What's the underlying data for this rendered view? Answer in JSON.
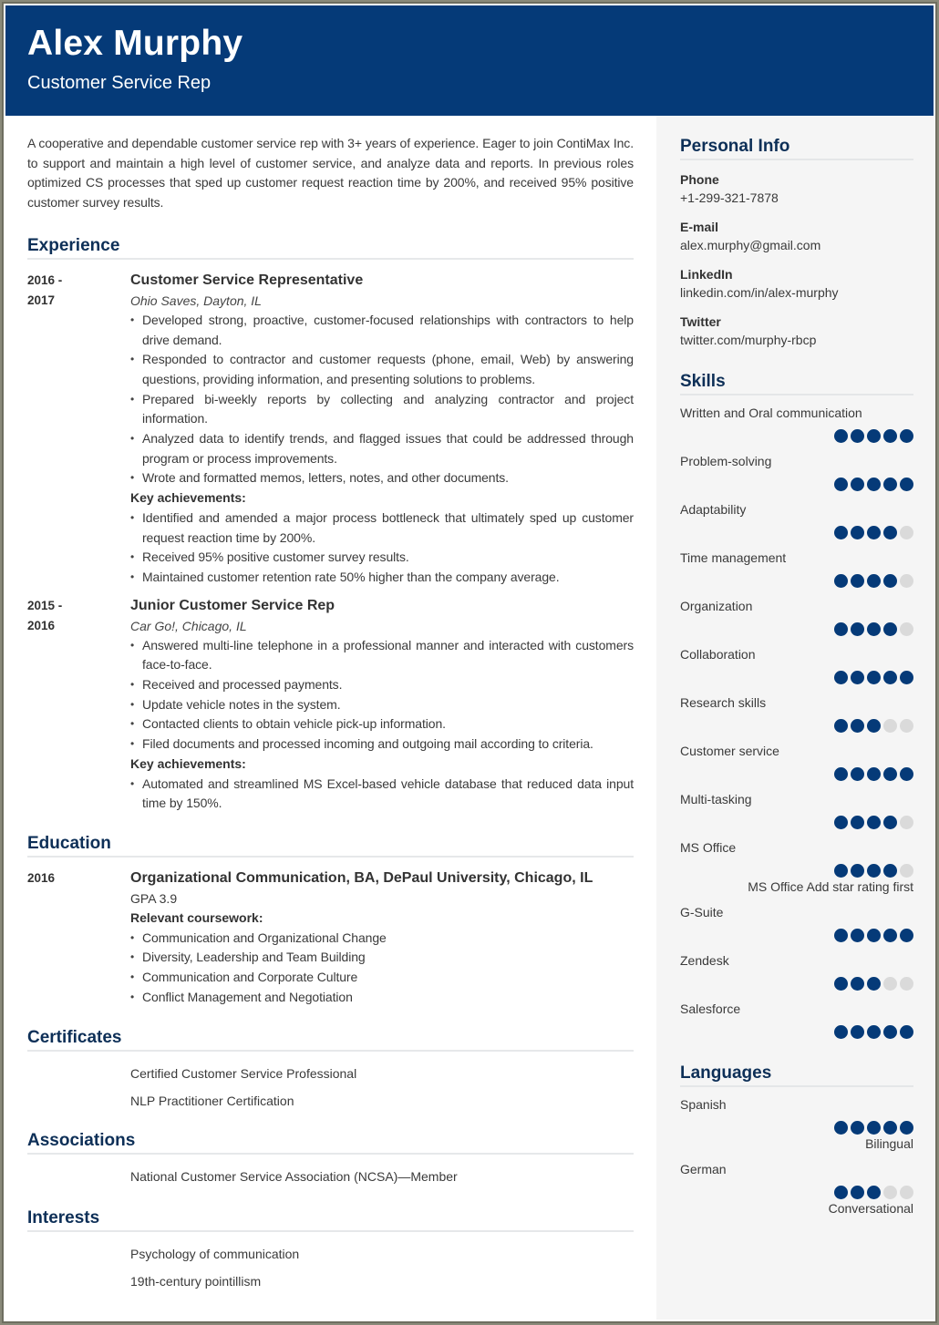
{
  "header": {
    "name": "Alex Murphy",
    "role": "Customer Service Rep"
  },
  "colors": {
    "accent": "#053a78",
    "heading": "#0d2f57",
    "sidebar_bg": "#f5f5f5",
    "dot_empty": "#dadada"
  },
  "summary": "A cooperative and dependable customer service rep with 3+ years of experience. Eager to join ContiMax Inc. to support and maintain a high level of customer service, and analyze data and reports. In previous roles optimized CS processes that sped up customer request reaction time by 200%, and received 95% positive customer survey results.",
  "experience": {
    "title": "Experience",
    "jobs": [
      {
        "date_start": "2016 -",
        "date_end": "2017",
        "title": "Customer Service Representative",
        "company": "Ohio Saves, Dayton, IL",
        "duties": [
          "Developed strong, proactive, customer-focused relationships with contractors to help drive demand.",
          "Responded to contractor and customer requests (phone, email, Web) by answering questions, providing information, and presenting solutions to problems.",
          "Prepared bi-weekly reports by collecting and analyzing contractor and project information.",
          "Analyzed data to identify trends, and flagged issues that could be addressed through program or process improvements.",
          "Wrote and formatted memos, letters, notes, and other documents."
        ],
        "key_label": "Key achievements:",
        "achievements": [
          "Identified and amended a major process bottleneck that ultimately sped up customer request reaction time by 200%.",
          "Received 95% positive customer survey results.",
          "Maintained customer retention rate 50% higher than the company average."
        ]
      },
      {
        "date_start": "2015 -",
        "date_end": "2016",
        "title": "Junior Customer Service Rep",
        "company": "Car Go!, Chicago, IL",
        "duties": [
          "Answered multi-line telephone in a professional manner and interacted with customers face-to-face.",
          "Received and processed payments.",
          "Update vehicle notes in the system.",
          "Contacted clients to obtain vehicle pick-up information.",
          "Filed documents and processed incoming and outgoing mail according to criteria."
        ],
        "key_label": "Key achievements:",
        "achievements": [
          "Automated and streamlined MS Excel-based vehicle database that reduced data input time by 150%."
        ]
      }
    ]
  },
  "education": {
    "title": "Education",
    "date": "2016",
    "degree": "Organizational Communication, BA, DePaul University, Chicago, IL",
    "gpa": "GPA 3.9",
    "coursework_label": "Relevant coursework:",
    "coursework": [
      "Communication and Organizational Change",
      "Diversity, Leadership and Team Building",
      "Communication and Corporate Culture",
      "Conflict Management and Negotiation"
    ]
  },
  "certificates": {
    "title": "Certificates",
    "items": [
      "Certified Customer Service Professional",
      "NLP Practitioner Certification"
    ]
  },
  "associations": {
    "title": "Associations",
    "items": [
      "National Customer Service Association (NCSA)—Member"
    ]
  },
  "interests": {
    "title": "Interests",
    "items": [
      "Psychology of communication",
      "19th-century pointillism"
    ]
  },
  "personal_info": {
    "title": "Personal Info",
    "fields": [
      {
        "label": "Phone",
        "value": "+1-299-321-7878"
      },
      {
        "label": "E-mail",
        "value": "alex.murphy@gmail.com"
      },
      {
        "label": "LinkedIn",
        "value": "linkedin.com/in/alex-murphy"
      },
      {
        "label": "Twitter",
        "value": "twitter.com/murphy-rbcp"
      }
    ]
  },
  "skills": {
    "title": "Skills",
    "max_rating": 5,
    "items": [
      {
        "name": "Written and Oral communication",
        "rating": 5
      },
      {
        "name": "Problem-solving",
        "rating": 5
      },
      {
        "name": "Adaptability",
        "rating": 4
      },
      {
        "name": "Time management",
        "rating": 4
      },
      {
        "name": "Organization",
        "rating": 4
      },
      {
        "name": "Collaboration",
        "rating": 5
      },
      {
        "name": "Research skills",
        "rating": 3
      },
      {
        "name": "Customer service",
        "rating": 5
      },
      {
        "name": "Multi-tasking",
        "rating": 4
      },
      {
        "name": "MS Office",
        "rating": 4,
        "note": "MS Office Add star rating first"
      },
      {
        "name": "G-Suite",
        "rating": 5
      },
      {
        "name": "Zendesk",
        "rating": 3
      },
      {
        "name": "Salesforce",
        "rating": 5
      }
    ]
  },
  "languages": {
    "title": "Languages",
    "max_rating": 5,
    "items": [
      {
        "name": "Spanish",
        "rating": 5,
        "level": "Bilingual"
      },
      {
        "name": "German",
        "rating": 3,
        "level": "Conversational"
      }
    ]
  }
}
